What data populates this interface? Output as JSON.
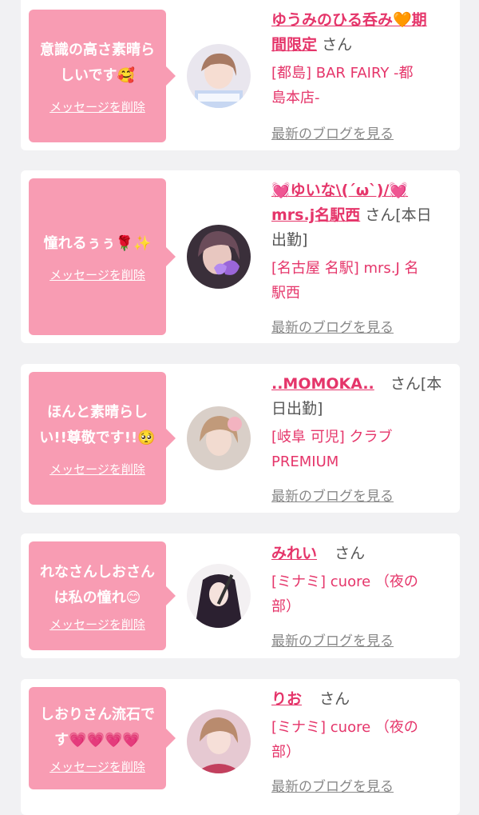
{
  "colors": {
    "bubble": "#f89cb3",
    "accent": "#e5356a",
    "muted": "#888888",
    "background": "#f1f1f3"
  },
  "delete_label": "メッセージを削除",
  "blog_label": "最新のブログを見る",
  "messages": [
    {
      "message": "意識の高さ素晴らしいです🥰",
      "name_line1": "ゆうみのひる呑み🧡期",
      "name_line2": "間限定",
      "suffix": "さん",
      "shop_line1": "[都島] BAR FAIRY -都",
      "shop_line2": "島本店-"
    },
    {
      "message": "憧れるぅぅ🌹✨",
      "name_line1": "💓ゆいな\\(´ω`)/💓",
      "name_line2": "mrs.j名駅西",
      "suffix": "さん[本日",
      "suffix2": "出勤]",
      "shop_line1": "[名古屋 名駅] mrs.J 名",
      "shop_line2": "駅西"
    },
    {
      "message_line1": "ほんと素晴らし",
      "message_line2": "い!!尊敬です!!🥺",
      "name_line1": "..MOMOKA..",
      "suffix": "さん[本",
      "suffix2": "日出勤]",
      "shop_line1": "[岐阜 可児] クラブ",
      "shop_line2": "PREMIUM"
    },
    {
      "message_line1": "れなさんしおさん",
      "message_line2": "は私の憧れ😊",
      "name_line1": "みれい",
      "suffix": "さん",
      "shop_line1": "[ミナミ] cuore （夜の",
      "shop_line2": "部）"
    },
    {
      "message_line1": "しおりさん流石で",
      "message_line2": "す💗💗💗💗",
      "name_line1": "りお",
      "suffix": "さん",
      "shop_line1": "[ミナミ] cuore （夜の",
      "shop_line2": "部）"
    }
  ]
}
